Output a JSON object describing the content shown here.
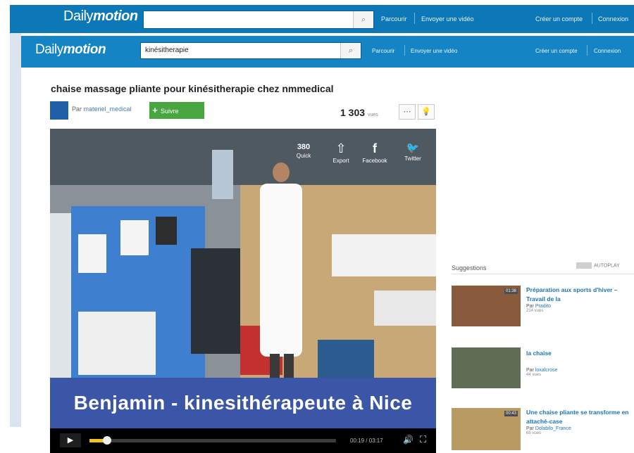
{
  "header_back": {
    "logo_a": "Daily",
    "logo_b": "motion",
    "search_value": "",
    "nav": [
      "Parcourir",
      "Envoyer une vidéo"
    ],
    "create_account": "Créer un compte",
    "login": "Connexion"
  },
  "header": {
    "logo_a": "Daily",
    "logo_b": "motion",
    "search_value": "kinésitherapie",
    "nav": [
      "Parcourir",
      "Envoyer une vidéo"
    ],
    "create_account": "Créer un compte",
    "login": "Connexion"
  },
  "video": {
    "title": "chaise massage pliante pour kinésitherapie chez nmmedical",
    "channel_prefix": "Par",
    "channel": "materiel_medical",
    "follow_label": "Suivre",
    "views": "1 303",
    "views_unit": "vues",
    "share": [
      {
        "label": "Quick",
        "icon": "380",
        "name": "quick"
      },
      {
        "label": "Export",
        "icon": "⇧",
        "name": "export"
      },
      {
        "label": "Facebook",
        "icon": "f",
        "name": "facebook"
      },
      {
        "label": "Twitter",
        "icon": "🐦",
        "name": "twitter"
      }
    ],
    "banner_text": "Benjamin - kinesithérapeute à Nice",
    "time": "00:19 / 03:17",
    "progress_fraction": 0.07
  },
  "suggestions": {
    "title": "Suggestions",
    "autoplay": "AUTOPLAY",
    "items": [
      {
        "title": "Préparation aux sports d'hiver – Travail de la",
        "by_prefix": "Par",
        "channel": "Pradito",
        "views": "214 vues",
        "duration": "01:38"
      },
      {
        "title": "la chaise",
        "by_prefix": "Par",
        "channel": "loxalcrose",
        "views": "44 vues",
        "duration": ""
      },
      {
        "title": "Une chaise pliante se transforme en attaché-case",
        "by_prefix": "Par",
        "channel": "Dolabilo_France",
        "views": "65 vues",
        "duration": "00:43"
      }
    ]
  },
  "colors": {
    "brand": "#0d78b8",
    "follow": "#48a641",
    "banner": "#3b56a6",
    "progress": "#f2c122"
  }
}
